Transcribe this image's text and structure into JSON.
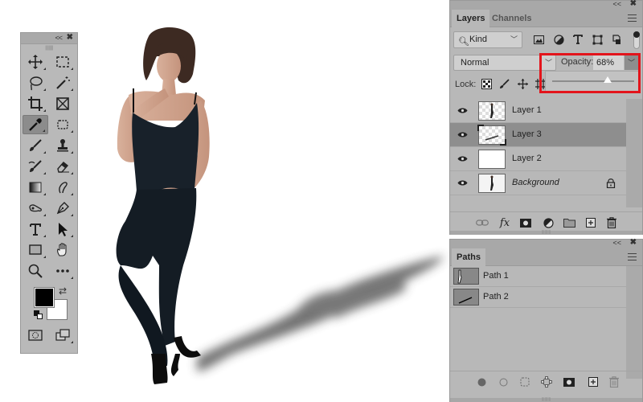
{
  "tools_panel": {
    "collapse_label": "<<",
    "close_label": "✖",
    "tools": [
      {
        "name": "move-tool",
        "icon": "move-icon"
      },
      {
        "name": "marquee-tool",
        "icon": "rectangular-marquee-icon"
      },
      {
        "name": "lasso-tool",
        "icon": "lasso-icon"
      },
      {
        "name": "magic-wand-tool",
        "icon": "magic-wand-icon"
      },
      {
        "name": "crop-tool",
        "icon": "crop-icon"
      },
      {
        "name": "frame-tool",
        "icon": "frame-icon"
      },
      {
        "name": "eyedropper-tool",
        "icon": "eyedropper-icon",
        "active": true
      },
      {
        "name": "patch-tool",
        "icon": "spot-healing-icon"
      },
      {
        "name": "brush-tool",
        "icon": "brush-icon"
      },
      {
        "name": "clone-stamp-tool",
        "icon": "stamp-icon"
      },
      {
        "name": "history-brush-tool",
        "icon": "history-brush-icon"
      },
      {
        "name": "eraser-tool",
        "icon": "eraser-icon"
      },
      {
        "name": "gradient-tool",
        "icon": "gradient-icon"
      },
      {
        "name": "smudge-tool",
        "icon": "smudge-icon"
      },
      {
        "name": "dodge-tool",
        "icon": "dodge-icon"
      },
      {
        "name": "pen-tool",
        "icon": "pen-icon"
      },
      {
        "name": "type-tool",
        "icon": "type-icon"
      },
      {
        "name": "path-selection-tool",
        "icon": "arrow-icon"
      },
      {
        "name": "rectangle-tool",
        "icon": "rectangle-icon"
      },
      {
        "name": "hand-tool",
        "icon": "hand-icon"
      },
      {
        "name": "zoom-tool",
        "icon": "magnifier-icon"
      },
      {
        "name": "more-tools",
        "icon": "ellipsis-icon"
      }
    ],
    "foreground_color": "#000000",
    "background_color": "#ffffff",
    "swap_label": "⇄"
  },
  "layers_panel": {
    "collapse_label": "<<",
    "close_label": "✖",
    "tabs": [
      {
        "label": "Layers",
        "active": true
      },
      {
        "label": "Channels",
        "active": false
      }
    ],
    "filter": {
      "kind_label": "Kind"
    },
    "blend_mode": "Normal",
    "opacity_label": "Opacity:",
    "opacity_value": "68%",
    "opacity_fraction": 0.68,
    "lock_label": "Lock:",
    "layers": [
      {
        "name": "Layer 1",
        "visible": true,
        "selected": false,
        "thumb": "figure-transparent"
      },
      {
        "name": "Layer 3",
        "visible": true,
        "selected": true,
        "thumb": "shadow-transparent"
      },
      {
        "name": "Layer 2",
        "visible": true,
        "selected": false,
        "thumb": "white"
      },
      {
        "name": "Background",
        "visible": true,
        "selected": false,
        "thumb": "figure-white",
        "locked": true
      }
    ]
  },
  "paths_panel": {
    "collapse_label": "<<",
    "close_label": "✖",
    "tab_label": "Paths",
    "paths": [
      {
        "name": "Path 1"
      },
      {
        "name": "Path 2"
      }
    ]
  },
  "colors": {
    "highlight": "#e3141b",
    "panel_bg": "#b8b8b8",
    "selected_row": "#8e8e8e"
  }
}
